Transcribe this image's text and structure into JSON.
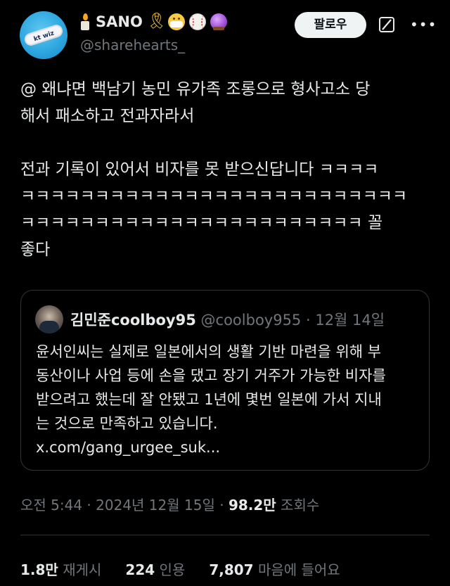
{
  "author": {
    "name": "SANO",
    "handle": "@sharehearts_",
    "avatar_text": "kt wiz",
    "name_emojis": [
      "ribbon-icon",
      "mask-face-icon",
      "baseball-icon",
      "crystal-ball-icon"
    ]
  },
  "header": {
    "follow_label": "팔로우"
  },
  "tweet": {
    "text": "@ 왜냐면 백남기 농민 유가족 조롱으로 형사고소 당\n해서 패소하고 전과자라서\n\n전과 기록이 있어서 비자를 못 받으신답니다 ㅋㅋㅋㅋ\nㅋㅋㅋㅋㅋㅋㅋㅋㅋㅋㅋㅋㅋㅋㅋㅋㅋㅋㅋㅋㅋㅋㅋㅋㅋㅋ\nㅋㅋㅋㅋㅋㅋㅋㅋㅋㅋㅋㅋㅋㅋㅋㅋㅋㅋㅋㅋㅋㅋㅋ 꼴\n좋다"
  },
  "quote": {
    "name": "김민준coolboy95",
    "handle": "@coolboy955",
    "date": "· 12월 14일",
    "text": "윤서인씨는 실제로 일본에서의 생활 기반 마련을 위해 부\n동산이나 사업 등에 손을 댔고 장기 거주가 가능한 비자를\n받으려고 했는데 잘 안됐고 1년에 몇번 일본에 가서 지내\n는 것으로 만족하고 있습니다.\nx.com/gang_urgee_suk..."
  },
  "meta": {
    "timestamp": "오전 5:44 · 2024년 12월 15일 · ",
    "views_count": "98.2만",
    "views_label": " 조회수"
  },
  "stats": [
    {
      "count": "1.8만",
      "label": " 재게시"
    },
    {
      "count": "224",
      "label": " 인용"
    },
    {
      "count": "7,807",
      "label": " 마음에 들어요"
    }
  ],
  "colors": {
    "background": "#000000",
    "text_primary": "#e7e9ea",
    "text_secondary": "#71767b",
    "border": "#2f3336",
    "button_bg": "#eff3f4"
  }
}
